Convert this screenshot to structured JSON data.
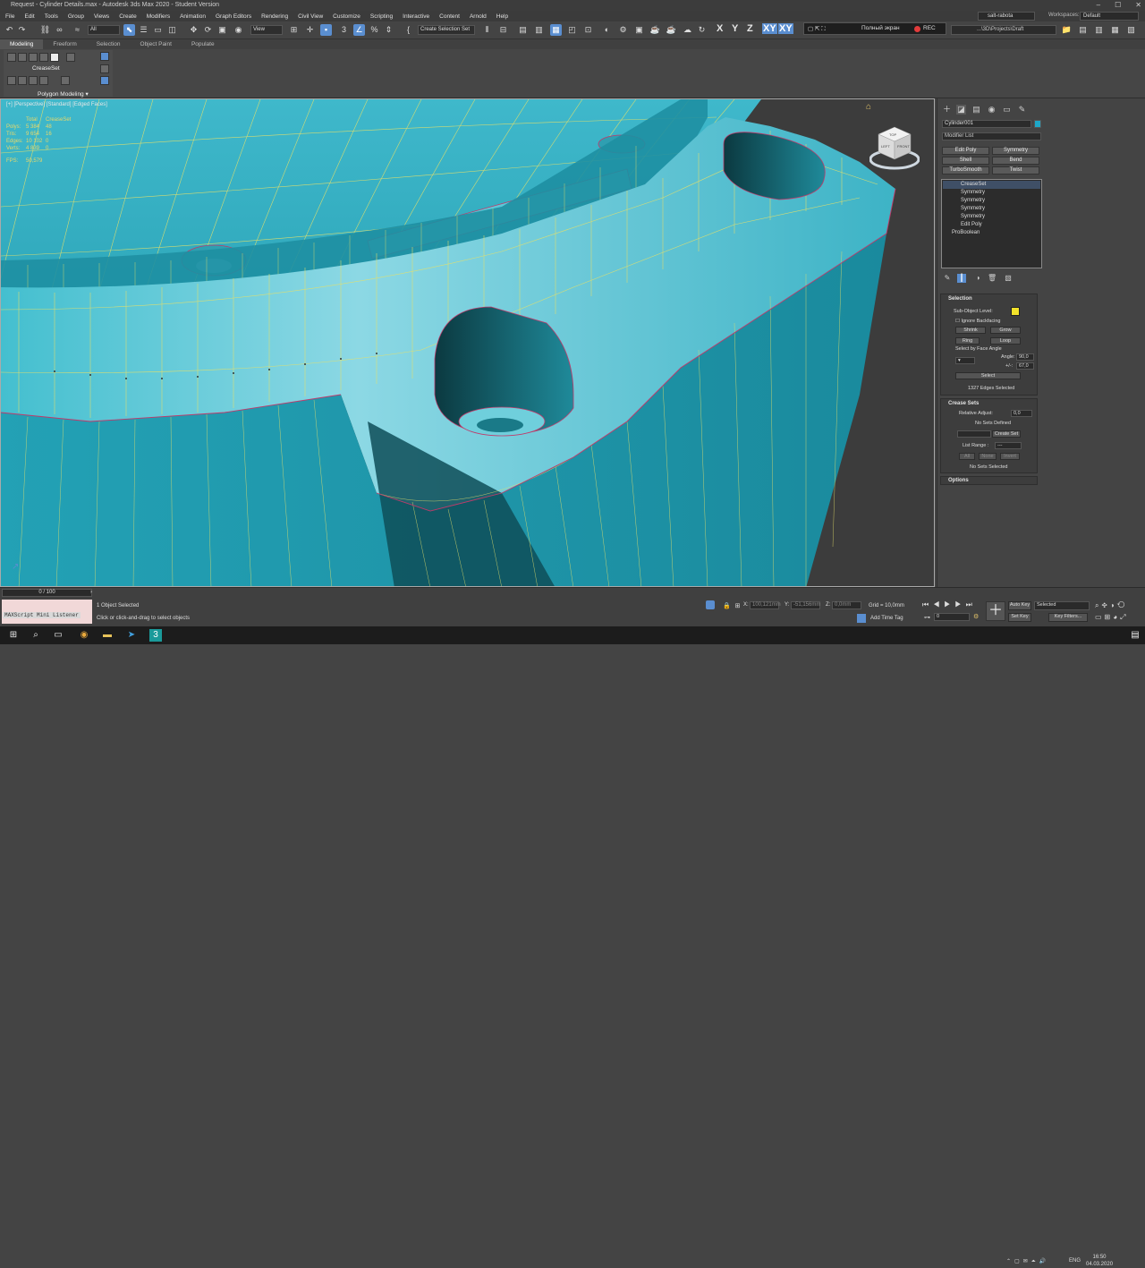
{
  "window": {
    "title": "Request - Cylinder Details.max - Autodesk 3ds Max 2020 - Student Version",
    "min": "–",
    "max": "☐",
    "close": "✕"
  },
  "menu": [
    "File",
    "Edit",
    "Tools",
    "Group",
    "Views",
    "Create",
    "Modifiers",
    "Animation",
    "Graph Editors",
    "Rendering",
    "Civil View",
    "Customize",
    "Scripting",
    "Interactive",
    "Content",
    "Arnold",
    "Help"
  ],
  "user": "salt-rabota",
  "workspace": {
    "label": "Workspaces:",
    "value": "Default"
  },
  "toolbar": {
    "filter": "All",
    "refcoord": "View",
    "selset": "Create Selection Set",
    "axes": [
      "X",
      "Y",
      "Z",
      "XY",
      "XY"
    ]
  },
  "recorder": {
    "fullscreen": "Полный экран",
    "rec": "REC"
  },
  "path": "...\\3D\\Projects\\Draft",
  "ribbon": {
    "tabs": [
      "Modeling",
      "Freeform",
      "Selection",
      "Object Paint",
      "Populate"
    ],
    "active": "Modeling",
    "crease": "CreaseSet",
    "polymodeling": "Polygon Modeling"
  },
  "viewport": {
    "label": "[+] [Perspective] [Standard] [Edged Faces]",
    "stats_header": [
      "",
      "Total",
      "CreaseSet"
    ],
    "stats": [
      [
        "Polys:",
        "5 384",
        "48"
      ],
      [
        "Tris:",
        "9 654",
        "16"
      ],
      [
        "Edges:",
        "10 102",
        "0"
      ],
      [
        "Verts:",
        "4 839",
        "0"
      ]
    ],
    "fps_label": "FPS:",
    "fps": "50,579",
    "cube": {
      "top": "TOP",
      "left": "LEFT",
      "front": "FRONT"
    }
  },
  "cmdpanel": {
    "object_name": "Cylinder001",
    "modifier_list": "Modifier List",
    "buttons": [
      "Edit Poly",
      "Symmetry",
      "Shell",
      "Bend",
      "TurboSmooth",
      "Twist"
    ],
    "stack": [
      "CreaseSet",
      "Symmetry",
      "Symmetry",
      "Symmetry",
      "Symmetry",
      "Edit Poly",
      "ProBoolean"
    ],
    "selection": {
      "title": "Selection",
      "sublevel": "Sub-Object Level:",
      "ignore": "Ignore Backfacing",
      "shrink": "Shrink",
      "grow": "Grow",
      "ring": "Ring",
      "loop": "Loop",
      "byface": "Select by Face Angle",
      "angle_lbl": "Angle:",
      "angle": "90,0",
      "pm_lbl": "+/-:",
      "pm": "67,0",
      "select": "Select",
      "status": "1327 Edges Selected"
    },
    "crease": {
      "title": "Crease Sets",
      "rel_lbl": "Relative Adjust:",
      "rel": "0,0",
      "nosets": "No Sets Defined",
      "create": "Create Set",
      "listrange": "List Range :",
      "listval": "---",
      "all": "All",
      "none": "None",
      "invert": "Invert",
      "nosel": "No Sets Selected"
    },
    "options": "Options"
  },
  "bottom": {
    "timeslider": "0 / 100",
    "maxscript": "MAXScript Mini Listener",
    "status1": "1 Object Selected",
    "status2": "Click or click-and-drag to select objects",
    "x_lbl": "X:",
    "x": "100,121mm",
    "y_lbl": "Y:",
    "y": "-51,156mm",
    "z_lbl": "Z:",
    "z": "0,0mm",
    "grid": "Grid = 10,0mm",
    "addtag": "Add Time Tag",
    "autokey": "Auto Key",
    "setkey": "Set Key",
    "selected": "Selected",
    "keyfilters": "Key Filters...",
    "frame": "0"
  },
  "taskbar": {
    "lang": "ENG",
    "time": "16:50",
    "date": "04.03.2020"
  },
  "colors": {
    "mesh": "#2aa0b4",
    "edge": "#e4e06a",
    "seam": "#c03a6a",
    "accent": "#5a8ed0"
  }
}
